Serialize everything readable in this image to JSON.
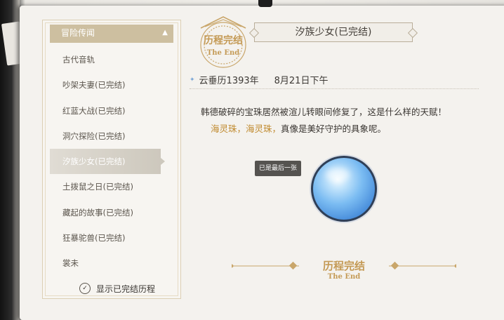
{
  "list": {
    "header_label": "冒险传闻",
    "items": [
      {
        "label": "古代音轨",
        "selected": false
      },
      {
        "label": "吵架夫妻(已完结)",
        "selected": false
      },
      {
        "label": "红蓝大战(已完结)",
        "selected": false
      },
      {
        "label": "洞穴探险(已完结)",
        "selected": false
      },
      {
        "label": "汐族少女(已完结)",
        "selected": true
      },
      {
        "label": "土拨鼠之日(已完结)",
        "selected": false
      },
      {
        "label": "藏起的故事(已完结)",
        "selected": false
      },
      {
        "label": "狂暴驼兽(已完结)",
        "selected": false
      },
      {
        "label": "裳未",
        "selected": false
      }
    ]
  },
  "toggle": {
    "label": "显示已完结历程",
    "checked": true
  },
  "seal": {
    "title": "历程完结",
    "subtitle": "The End"
  },
  "detail": {
    "title": "汐族少女(已完结)",
    "date_year": "云垂历1393年",
    "date_day": "8月21日下午",
    "line1": "韩德破碎的宝珠居然被渲儿转眼间修复了，这是什么样的天赋！",
    "line2_highlight": "海灵珠，海灵珠，",
    "line2_rest": "真像是美好守护的具象呢。",
    "tooltip": "已是最后一张"
  },
  "footer": {
    "title": "历程完结",
    "subtitle": "The End"
  },
  "colors": {
    "gold": "#c49a55",
    "highlight": "#c08a2e",
    "orb": "#7bbcf2"
  }
}
